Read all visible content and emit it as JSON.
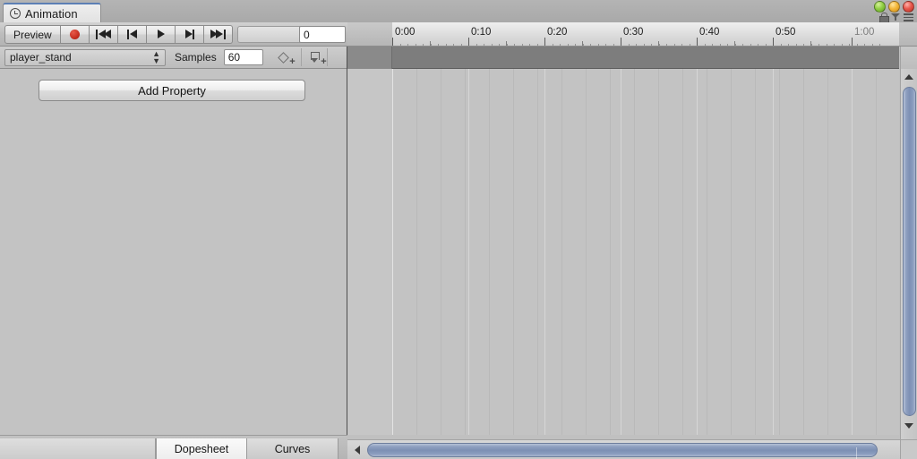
{
  "window": {
    "tab_label": "Animation",
    "tab_icon": "clock-icon",
    "controls": {
      "close_color": "#e8584c",
      "minimize_color": "#f4b83c",
      "maximize_color": "#92cf45",
      "lock_icon": "lock-icon",
      "filter_icon": "filter-dropdown-icon",
      "menu_icon": "hamburger-menu-icon"
    }
  },
  "toolbar": {
    "preview_label": "Preview",
    "record_icon": "record-dot-icon",
    "first_frame_icon": "skip-to-start-icon",
    "prev_frame_icon": "step-back-icon",
    "play_icon": "play-icon",
    "next_frame_icon": "step-forward-icon",
    "last_frame_icon": "skip-to-end-icon",
    "frame_value": "0"
  },
  "clip_bar": {
    "clip_name": "player_stand",
    "samples_label": "Samples",
    "samples_value": "60",
    "add_keyframe_icon": "add-keyframe-icon",
    "add_event_icon": "add-event-icon"
  },
  "properties": {
    "add_property_label": "Add Property"
  },
  "timeline": {
    "labels": [
      "0:00",
      "0:10",
      "0:20",
      "0:30",
      "0:40",
      "0:50",
      "1:00"
    ],
    "label_positions": [
      50,
      135,
      220,
      305,
      390,
      475,
      563
    ],
    "dimmed_label_index": 6,
    "major_tick_positions": [
      50,
      135,
      220,
      305,
      390,
      475,
      563
    ],
    "minor_tick_positions": [
      92,
      177,
      262,
      347,
      432,
      517
    ],
    "tiny_tick_step": 8.5,
    "grid_positions": [
      50,
      77,
      104,
      131,
      158,
      185,
      212,
      239,
      266,
      293,
      320,
      347,
      374,
      401,
      428,
      455,
      482,
      509,
      536,
      563,
      590
    ],
    "major_grid_positions": [
      50,
      135,
      220,
      305,
      390,
      475,
      563
    ]
  },
  "bottom_tabs": {
    "items": [
      {
        "label": "Dopesheet",
        "active": true
      },
      {
        "label": "Curves",
        "active": false
      }
    ]
  },
  "scrollbars": {
    "h_left_icon": "scroll-left-arrow-icon",
    "h_right_icon": "scroll-right-arrow-icon",
    "v_up_icon": "scroll-up-arrow-icon",
    "v_down_icon": "scroll-down-arrow-icon"
  }
}
